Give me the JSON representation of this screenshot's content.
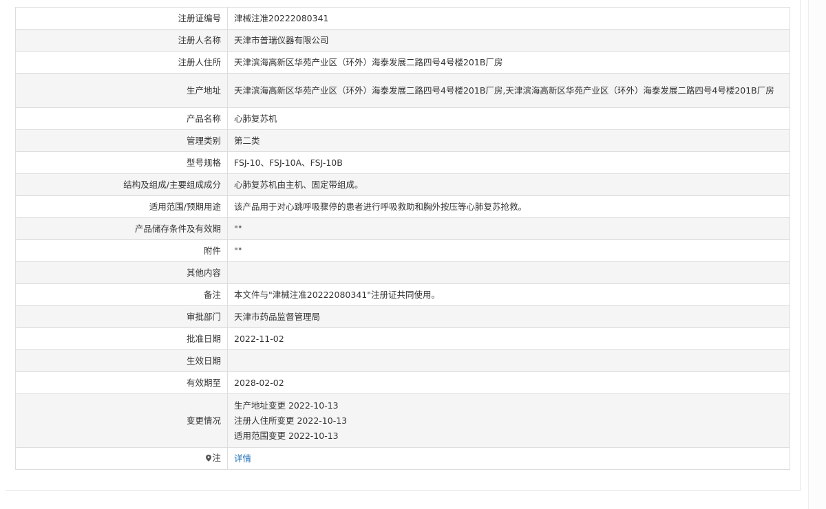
{
  "rows": [
    {
      "label": "注册证编号",
      "value": "津械注准20222080341"
    },
    {
      "label": "注册人名称",
      "value": "天津市普瑞仪器有限公司"
    },
    {
      "label": "注册人住所",
      "value": "天津滨海高新区华苑产业区（环外）海泰发展二路四号4号楼201B厂房"
    },
    {
      "label": "生产地址",
      "value": "天津滨海高新区华苑产业区（环外）海泰发展二路四号4号楼201B厂房,天津滨海高新区华苑产业区（环外）海泰发展二路四号4号楼201B厂房"
    },
    {
      "label": "产品名称",
      "value": "心肺复苏机"
    },
    {
      "label": "管理类别",
      "value": "第二类"
    },
    {
      "label": "型号规格",
      "value": "FSJ-10、FSJ-10A、FSJ-10B"
    },
    {
      "label": "结构及组成/主要组成成分",
      "value": "心肺复苏机由主机、固定带组成。"
    },
    {
      "label": "适用范围/预期用途",
      "value": "该产品用于对心跳呼吸骤停的患者进行呼吸救助和胸外按压等心肺复苏抢救。"
    },
    {
      "label": "产品储存条件及有效期",
      "value": "\"\""
    },
    {
      "label": "附件",
      "value": "\"\""
    },
    {
      "label": "其他内容",
      "value": ""
    },
    {
      "label": "备注",
      "value": "本文件与\"津械注准20222080341\"注册证共同使用。"
    },
    {
      "label": "审批部门",
      "value": "天津市药品监督管理局"
    },
    {
      "label": "批准日期",
      "value": "2022-11-02"
    },
    {
      "label": "生效日期",
      "value": ""
    },
    {
      "label": "有效期至",
      "value": "2028-02-02"
    }
  ],
  "changes": {
    "label": "变更情况",
    "items": [
      "生产地址变更 2022-10-13",
      "注册人住所变更 2022-10-13",
      "适用范围变更 2022-10-13"
    ]
  },
  "note": {
    "label": "注",
    "icon": "location-pin-icon",
    "link_text": "详情"
  }
}
